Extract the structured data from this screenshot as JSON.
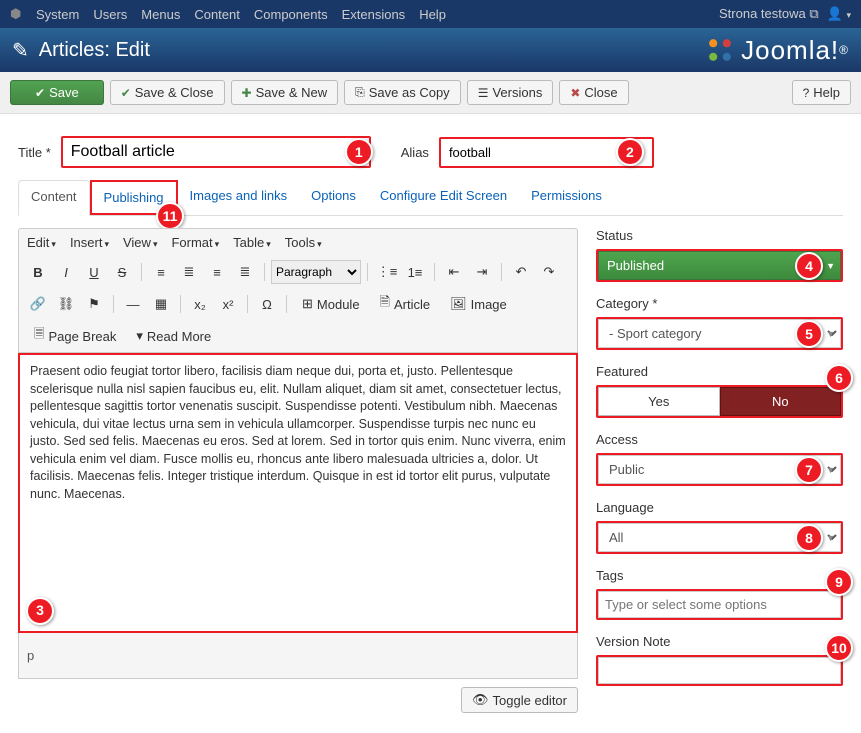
{
  "topmenu": [
    "System",
    "Users",
    "Menus",
    "Content",
    "Components",
    "Extensions",
    "Help"
  ],
  "site_name": "Strona testowa",
  "page_heading": "Articles: Edit",
  "brand": "Joomla!",
  "toolbar": {
    "save": "Save",
    "save_close": "Save & Close",
    "save_new": "Save & New",
    "save_copy": "Save as Copy",
    "versions": "Versions",
    "close": "Close",
    "help": "Help"
  },
  "title_label": "Title *",
  "title_value": "Football article",
  "alias_label": "Alias",
  "alias_value": "football",
  "tabs": [
    "Content",
    "Publishing",
    "Images and links",
    "Options",
    "Configure Edit Screen",
    "Permissions"
  ],
  "active_tab": 0,
  "editor_menus": [
    "Edit",
    "Insert",
    "View",
    "Format",
    "Table",
    "Tools"
  ],
  "format_select": "Paragraph",
  "tb_labels": {
    "module": "Module",
    "article": "Article",
    "image": "Image",
    "pagebreak": "Page Break",
    "readmore": "Read More"
  },
  "editor_content": "Praesent odio feugiat tortor libero, facilisis diam neque dui, porta et, justo. Pellentesque scelerisque nulla nisl sapien faucibus eu, elit. Nullam aliquet, diam sit amet, consectetuer lectus, pellentesque sagittis tortor venenatis suscipit. Suspendisse potenti. Vestibulum nibh. Maecenas vehicula, dui vitae lectus urna sem in vehicula ullamcorper. Suspendisse turpis nec nunc eu justo. Sed sed felis. Maecenas eu eros. Sed at lorem. Sed in tortor quis enim. Nunc viverra, enim vehicula enim vel diam. Fusce mollis eu, rhoncus ante libero malesuada ultricies a, dolor. Ut facilisis. Maecenas felis. Integer tristique interdum. Quisque in est id tortor elit purus, vulputate nunc. Maecenas.",
  "status_path": "p",
  "toggle_editor": "Toggle editor",
  "side": {
    "status_label": "Status",
    "status_value": "Published",
    "category_label": "Category *",
    "category_value": "- Sport category",
    "featured_label": "Featured",
    "featured_yes": "Yes",
    "featured_no": "No",
    "access_label": "Access",
    "access_value": "Public",
    "language_label": "Language",
    "language_value": "All",
    "tags_label": "Tags",
    "tags_placeholder": "Type or select some options",
    "version_label": "Version Note"
  },
  "badges": {
    "1": "1",
    "2": "2",
    "3": "3",
    "4": "4",
    "5": "5",
    "6": "6",
    "7": "7",
    "8": "8",
    "9": "9",
    "10": "10",
    "11": "11"
  }
}
